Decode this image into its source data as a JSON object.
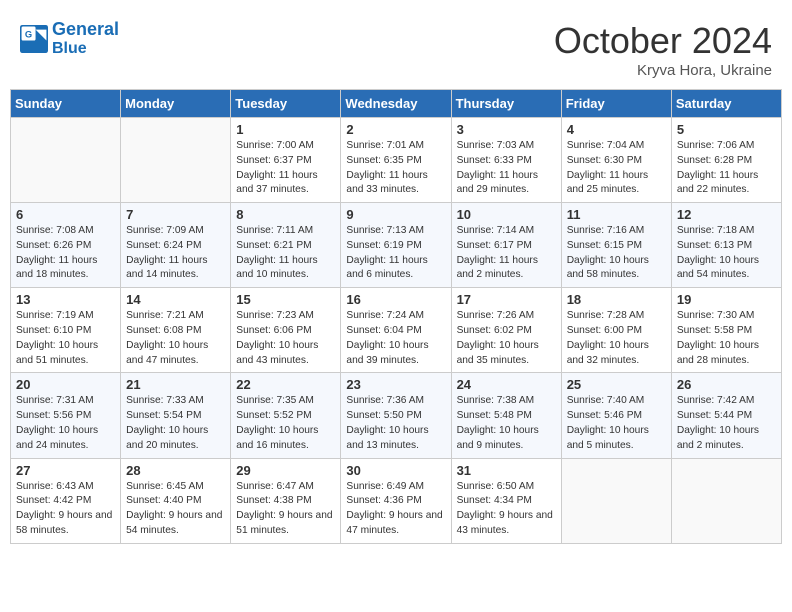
{
  "header": {
    "logo_line1": "General",
    "logo_line2": "Blue",
    "month": "October 2024",
    "location": "Kryva Hora, Ukraine"
  },
  "weekdays": [
    "Sunday",
    "Monday",
    "Tuesday",
    "Wednesday",
    "Thursday",
    "Friday",
    "Saturday"
  ],
  "weeks": [
    [
      {
        "day": "",
        "info": ""
      },
      {
        "day": "",
        "info": ""
      },
      {
        "day": "1",
        "info": "Sunrise: 7:00 AM\nSunset: 6:37 PM\nDaylight: 11 hours and 37 minutes."
      },
      {
        "day": "2",
        "info": "Sunrise: 7:01 AM\nSunset: 6:35 PM\nDaylight: 11 hours and 33 minutes."
      },
      {
        "day": "3",
        "info": "Sunrise: 7:03 AM\nSunset: 6:33 PM\nDaylight: 11 hours and 29 minutes."
      },
      {
        "day": "4",
        "info": "Sunrise: 7:04 AM\nSunset: 6:30 PM\nDaylight: 11 hours and 25 minutes."
      },
      {
        "day": "5",
        "info": "Sunrise: 7:06 AM\nSunset: 6:28 PM\nDaylight: 11 hours and 22 minutes."
      }
    ],
    [
      {
        "day": "6",
        "info": "Sunrise: 7:08 AM\nSunset: 6:26 PM\nDaylight: 11 hours and 18 minutes."
      },
      {
        "day": "7",
        "info": "Sunrise: 7:09 AM\nSunset: 6:24 PM\nDaylight: 11 hours and 14 minutes."
      },
      {
        "day": "8",
        "info": "Sunrise: 7:11 AM\nSunset: 6:21 PM\nDaylight: 11 hours and 10 minutes."
      },
      {
        "day": "9",
        "info": "Sunrise: 7:13 AM\nSunset: 6:19 PM\nDaylight: 11 hours and 6 minutes."
      },
      {
        "day": "10",
        "info": "Sunrise: 7:14 AM\nSunset: 6:17 PM\nDaylight: 11 hours and 2 minutes."
      },
      {
        "day": "11",
        "info": "Sunrise: 7:16 AM\nSunset: 6:15 PM\nDaylight: 10 hours and 58 minutes."
      },
      {
        "day": "12",
        "info": "Sunrise: 7:18 AM\nSunset: 6:13 PM\nDaylight: 10 hours and 54 minutes."
      }
    ],
    [
      {
        "day": "13",
        "info": "Sunrise: 7:19 AM\nSunset: 6:10 PM\nDaylight: 10 hours and 51 minutes."
      },
      {
        "day": "14",
        "info": "Sunrise: 7:21 AM\nSunset: 6:08 PM\nDaylight: 10 hours and 47 minutes."
      },
      {
        "day": "15",
        "info": "Sunrise: 7:23 AM\nSunset: 6:06 PM\nDaylight: 10 hours and 43 minutes."
      },
      {
        "day": "16",
        "info": "Sunrise: 7:24 AM\nSunset: 6:04 PM\nDaylight: 10 hours and 39 minutes."
      },
      {
        "day": "17",
        "info": "Sunrise: 7:26 AM\nSunset: 6:02 PM\nDaylight: 10 hours and 35 minutes."
      },
      {
        "day": "18",
        "info": "Sunrise: 7:28 AM\nSunset: 6:00 PM\nDaylight: 10 hours and 32 minutes."
      },
      {
        "day": "19",
        "info": "Sunrise: 7:30 AM\nSunset: 5:58 PM\nDaylight: 10 hours and 28 minutes."
      }
    ],
    [
      {
        "day": "20",
        "info": "Sunrise: 7:31 AM\nSunset: 5:56 PM\nDaylight: 10 hours and 24 minutes."
      },
      {
        "day": "21",
        "info": "Sunrise: 7:33 AM\nSunset: 5:54 PM\nDaylight: 10 hours and 20 minutes."
      },
      {
        "day": "22",
        "info": "Sunrise: 7:35 AM\nSunset: 5:52 PM\nDaylight: 10 hours and 16 minutes."
      },
      {
        "day": "23",
        "info": "Sunrise: 7:36 AM\nSunset: 5:50 PM\nDaylight: 10 hours and 13 minutes."
      },
      {
        "day": "24",
        "info": "Sunrise: 7:38 AM\nSunset: 5:48 PM\nDaylight: 10 hours and 9 minutes."
      },
      {
        "day": "25",
        "info": "Sunrise: 7:40 AM\nSunset: 5:46 PM\nDaylight: 10 hours and 5 minutes."
      },
      {
        "day": "26",
        "info": "Sunrise: 7:42 AM\nSunset: 5:44 PM\nDaylight: 10 hours and 2 minutes."
      }
    ],
    [
      {
        "day": "27",
        "info": "Sunrise: 6:43 AM\nSunset: 4:42 PM\nDaylight: 9 hours and 58 minutes."
      },
      {
        "day": "28",
        "info": "Sunrise: 6:45 AM\nSunset: 4:40 PM\nDaylight: 9 hours and 54 minutes."
      },
      {
        "day": "29",
        "info": "Sunrise: 6:47 AM\nSunset: 4:38 PM\nDaylight: 9 hours and 51 minutes."
      },
      {
        "day": "30",
        "info": "Sunrise: 6:49 AM\nSunset: 4:36 PM\nDaylight: 9 hours and 47 minutes."
      },
      {
        "day": "31",
        "info": "Sunrise: 6:50 AM\nSunset: 4:34 PM\nDaylight: 9 hours and 43 minutes."
      },
      {
        "day": "",
        "info": ""
      },
      {
        "day": "",
        "info": ""
      }
    ]
  ]
}
